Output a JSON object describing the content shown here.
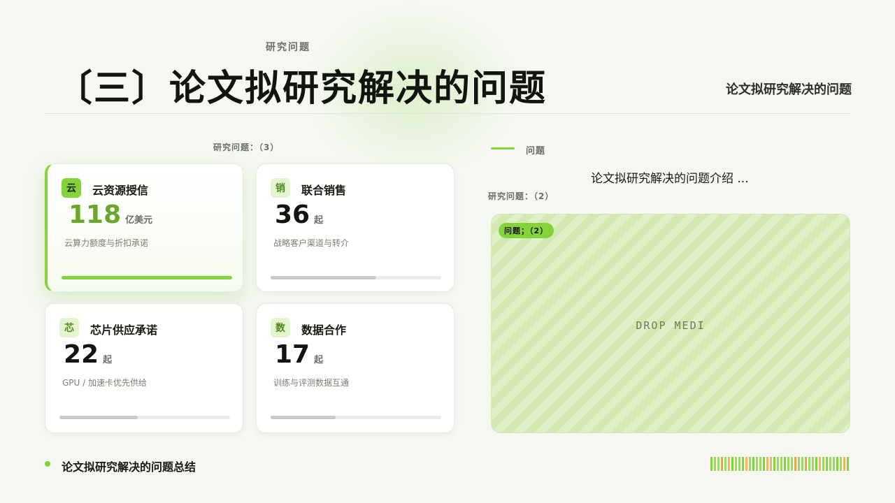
{
  "header": {
    "eyebrow": "研究问题",
    "title": "〔三〕论文拟研究解决的问题",
    "side_title": "论文拟研究解决的问题"
  },
  "cards_section": {
    "count_label": "研究问题：（3）",
    "cards": [
      {
        "icon": "云",
        "title": "云资源授信",
        "value": "118",
        "unit": "亿美元",
        "desc": "云算力额度与折扣承诺",
        "progress": 1.0,
        "active": true
      },
      {
        "icon": "销",
        "title": "联合销售",
        "value": "36",
        "unit": "起",
        "desc": "战略客户渠道与转介",
        "progress": 0.62,
        "active": false
      },
      {
        "icon": "芯",
        "title": "芯片供应承诺",
        "value": "22",
        "unit": "起",
        "desc": "GPU / 加速卡优先供给",
        "progress": 0.46,
        "active": false
      },
      {
        "icon": "数",
        "title": "数据合作",
        "value": "17",
        "unit": "起",
        "desc": "训练与评测数据互通",
        "progress": 0.38,
        "active": false
      }
    ]
  },
  "right_panel": {
    "section_label": "问题",
    "intro": "论文拟研究解决的问题介绍 ...",
    "count_label": "研究问题：（2）",
    "drop_badge": "问题；（2）",
    "drop_text": "DROP MEDI"
  },
  "footer": {
    "summary": "论文拟研究解决的问题总结"
  },
  "colors": {
    "accent": "#84d33b",
    "stripe_palette": [
      "#84d33b",
      "#84d33b",
      "#f0a33a",
      "#84d33b",
      "#f0a33a",
      "#84d33b"
    ]
  }
}
